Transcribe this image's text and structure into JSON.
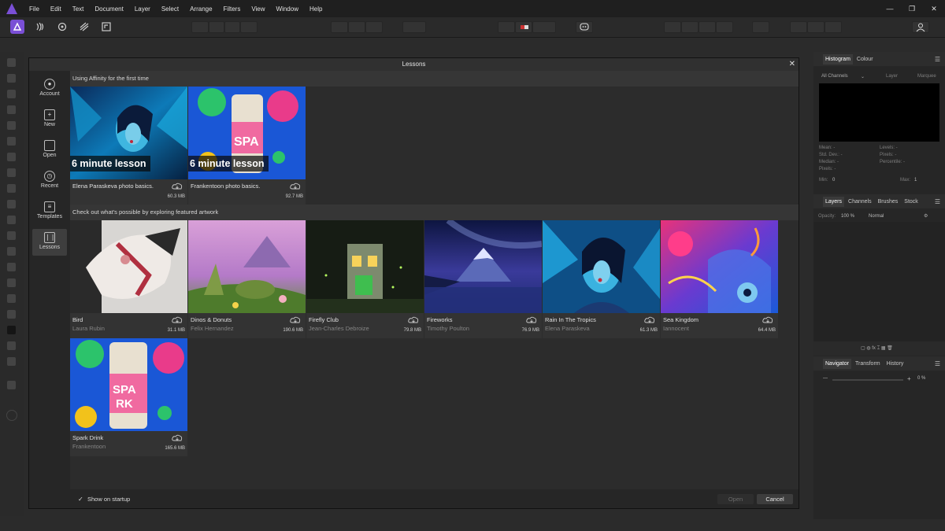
{
  "menu": {
    "items": [
      "File",
      "Edit",
      "Text",
      "Document",
      "Layer",
      "Select",
      "Arrange",
      "Filters",
      "View",
      "Window",
      "Help"
    ]
  },
  "window_controls": [
    "—",
    "❐",
    "✕"
  ],
  "personas": [
    "photo-persona-icon",
    "liquify-persona-icon",
    "develop-persona-icon",
    "tone-mapping-persona-icon",
    "export-persona-icon"
  ],
  "dialog": {
    "title": "Lessons",
    "nav": [
      {
        "label": "Account",
        "icon": "account-icon"
      },
      {
        "label": "New",
        "icon": "new-document-icon"
      },
      {
        "label": "Open",
        "icon": "folder-icon"
      },
      {
        "label": "Recent",
        "icon": "clock-icon"
      },
      {
        "label": "Templates",
        "icon": "templates-icon"
      },
      {
        "label": "Lessons",
        "icon": "book-icon",
        "active": true
      }
    ],
    "section1": "Using Affinity for the first time",
    "section2": "Check out what's possible by exploring featured artwork",
    "lessons": [
      {
        "badge": "6 minute lesson",
        "title": "Elena Paraskeva photo basics.",
        "author": "",
        "size": "60.3 MB"
      },
      {
        "badge": "6 minute lesson",
        "title": "Frankentoon photo basics.",
        "author": "",
        "size": "92.7 MB"
      }
    ],
    "artwork": [
      {
        "title": "Bird",
        "author": "Laura Rubin",
        "size": "31.1 MB"
      },
      {
        "title": "Dinos & Donuts",
        "author": "Felix Hernandez",
        "size": "190.6 MB"
      },
      {
        "title": "Firefly Club",
        "author": "Jean-Charles Debroize",
        "size": "79.8 MB"
      },
      {
        "title": "Fireworks",
        "author": "Timothy Poulton",
        "size": "76.9 MB"
      },
      {
        "title": "Rain In The Tropics",
        "author": "Elena Paraskeva",
        "size": "61.3 MB"
      },
      {
        "title": "Sea Kingdom",
        "author": "Iannocent",
        "size": "64.4 MB"
      },
      {
        "title": "Spark Drink",
        "author": "Frankentoon",
        "size": "165.6 MB"
      }
    ],
    "footer": {
      "show_on_startup": "Show on startup",
      "show_on_startup_checked": true,
      "open_label": "Open",
      "cancel_label": "Cancel"
    }
  },
  "panels": {
    "histogram": {
      "tabs": [
        "Histogram",
        "Colour"
      ],
      "channel": "All Channels",
      "layer_opt": "Layer",
      "marquee_opt": "Marquee",
      "stats_left": [
        "Mean: -",
        "Std. Dev.: -",
        "Median: -",
        "Pixels: -"
      ],
      "stats_right": [
        "Levels: -",
        "Pixels: -",
        "Percentile: -"
      ],
      "min_label": "Min:",
      "min_value": "0",
      "max_label": "Max:",
      "max_value": "1"
    },
    "layers": {
      "tabs": [
        "Layers",
        "Channels",
        "Brushes",
        "Stock"
      ],
      "opacity_label": "Opacity:",
      "opacity_value": "100 %",
      "blend_mode": "Normal"
    },
    "navigator": {
      "tabs": [
        "Navigator",
        "Transform",
        "History"
      ],
      "zoom": "0 %"
    }
  },
  "colors": {
    "accent": "#7a4fd6",
    "dialog_bg": "#262626",
    "content_bg": "#2c2c2c"
  }
}
